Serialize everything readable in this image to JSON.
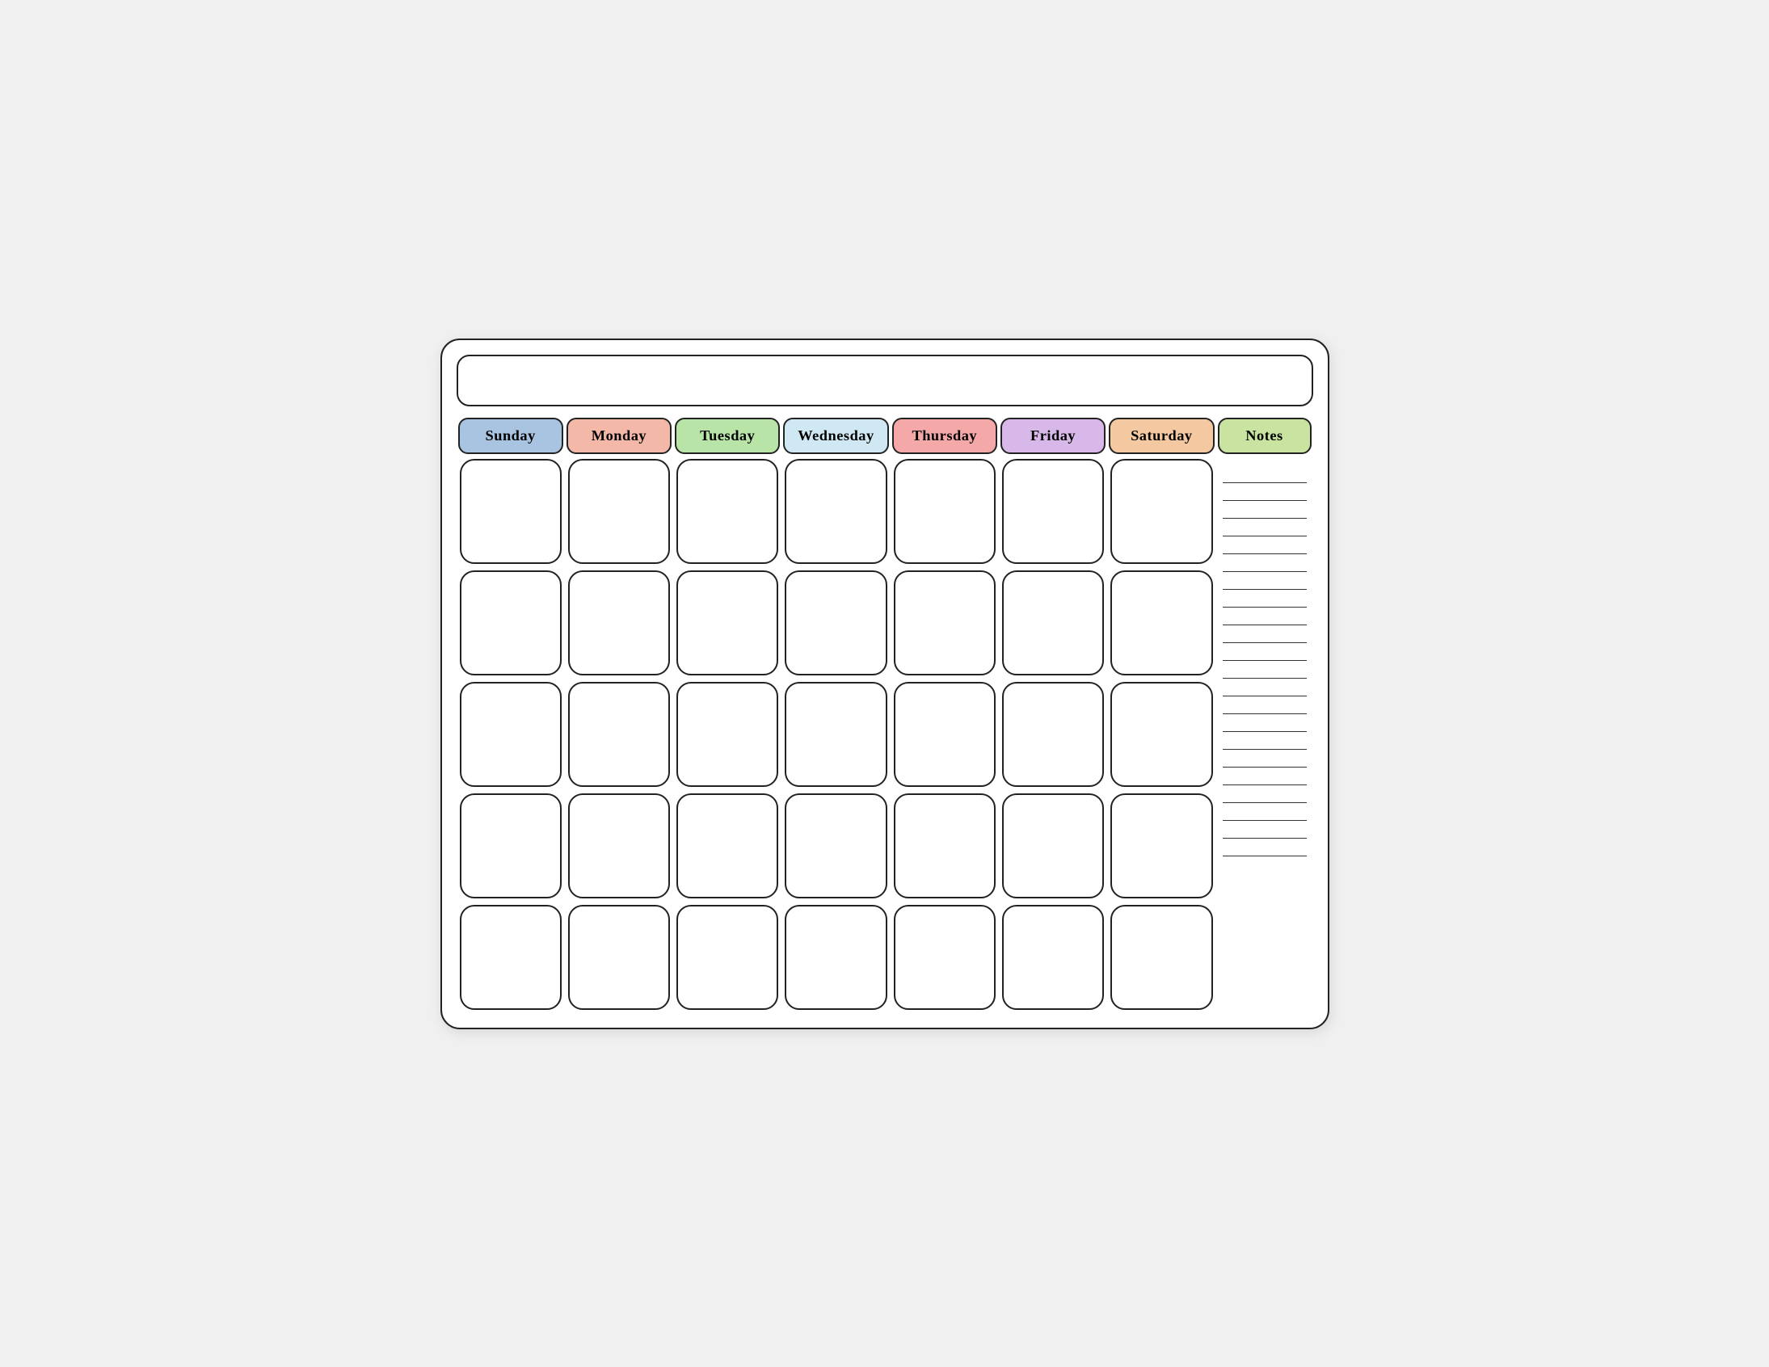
{
  "calendar": {
    "title": "",
    "headers": [
      {
        "id": "sunday",
        "label": "Sunday",
        "class": "header-sunday"
      },
      {
        "id": "monday",
        "label": "Monday",
        "class": "header-monday"
      },
      {
        "id": "tuesday",
        "label": "Tuesday",
        "class": "header-tuesday"
      },
      {
        "id": "wednesday",
        "label": "Wednesday",
        "class": "header-wednesday"
      },
      {
        "id": "thursday",
        "label": "Thursday",
        "class": "header-thursday"
      },
      {
        "id": "friday",
        "label": "Friday",
        "class": "header-friday"
      },
      {
        "id": "saturday",
        "label": "Saturday",
        "class": "header-saturday"
      },
      {
        "id": "notes",
        "label": "Notes",
        "class": "header-notes"
      }
    ],
    "rows": 5,
    "cols": 7,
    "notes_lines": 22
  }
}
